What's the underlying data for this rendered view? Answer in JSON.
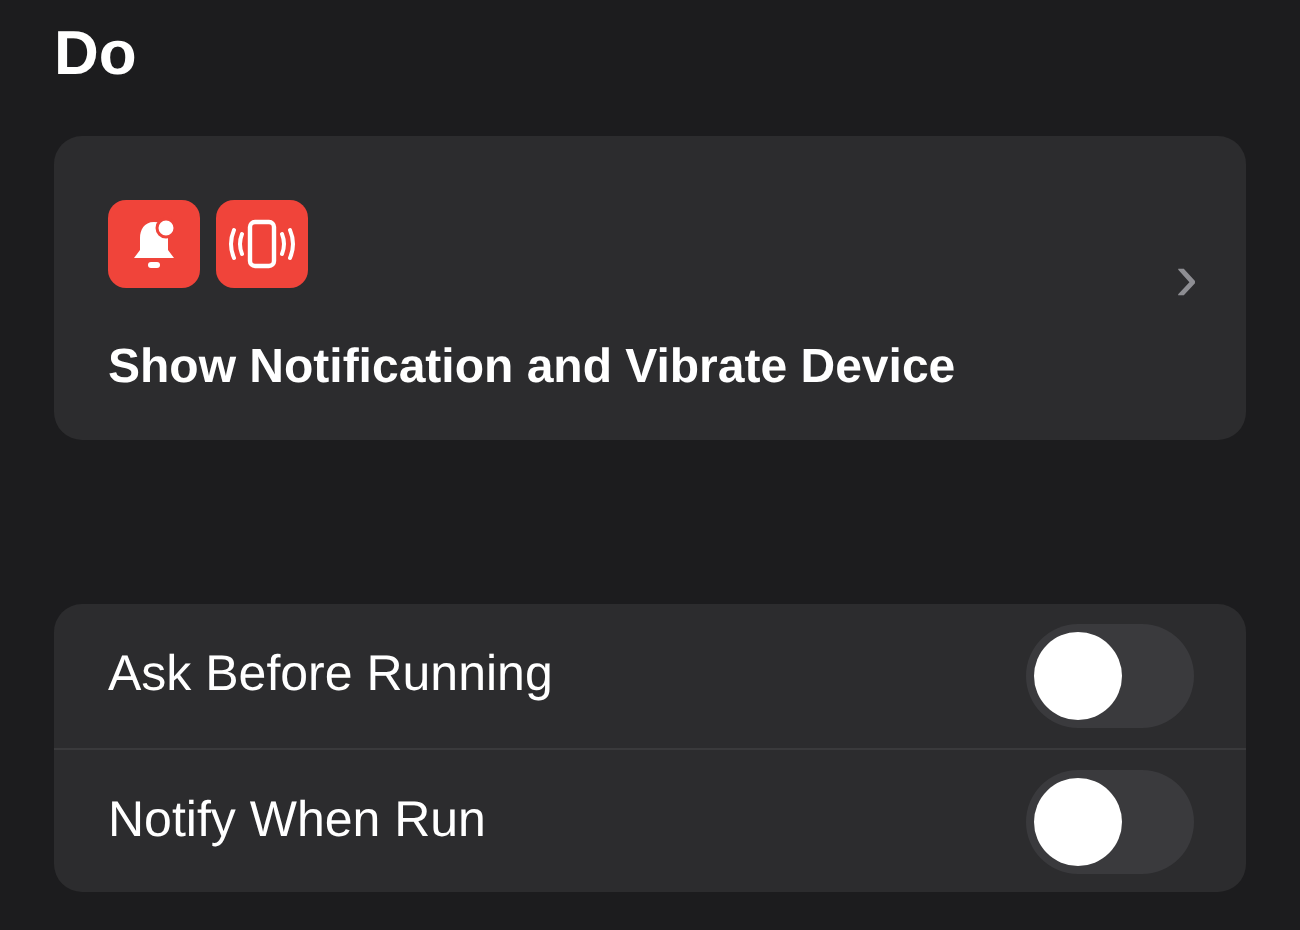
{
  "section_title": "Do",
  "action": {
    "title": "Show Notification and Vibrate Device",
    "chevron": "›"
  },
  "settings": [
    {
      "label": "Ask Before Running",
      "on": false
    },
    {
      "label": "Notify When Run",
      "on": false
    }
  ]
}
